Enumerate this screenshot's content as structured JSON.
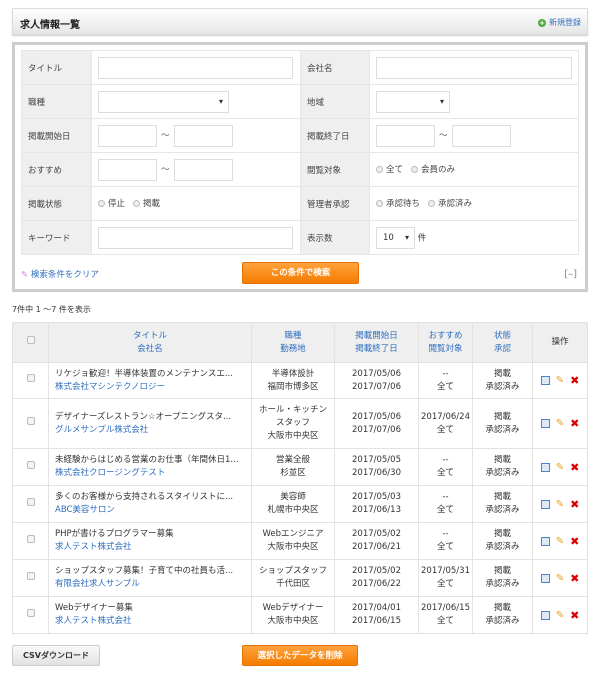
{
  "header": {
    "title": "求人情報一覧",
    "new_label": "新規登録"
  },
  "search": {
    "title_label": "タイトル",
    "company_label": "会社名",
    "job_label": "職種",
    "area_label": "地域",
    "start_label": "掲載開始日",
    "end_label": "掲載終了日",
    "tilde": "～",
    "recommend_label": "おすすめ",
    "view_label": "閲覧対象",
    "view_options": [
      "全て",
      "会員のみ"
    ],
    "status_label": "掲載状態",
    "status_options": [
      "停止",
      "掲載"
    ],
    "approval_label": "管理者承認",
    "approval_options": [
      "承認待ち",
      "承認済み"
    ],
    "keyword_label": "キーワード",
    "count_label": "表示数",
    "count_value": "10",
    "count_unit": "件",
    "clear_label": "検索条件をクリア",
    "search_button": "この条件で検索",
    "collapse": "[–]"
  },
  "result_count": "7件中 1 ～7 件を表示",
  "table": {
    "headers": [
      [
        "タイトル",
        "会社名"
      ],
      [
        "職種",
        "勤務地"
      ],
      [
        "掲載開始日",
        "掲載終了日"
      ],
      [
        "おすすめ",
        "閲覧対象"
      ],
      [
        "状態",
        "承認"
      ],
      [
        "操作"
      ]
    ],
    "rows": [
      {
        "title": "リケジョ歓迎！半導体装置のメンテナンスエ...",
        "company": "株式会社マシンテクノロジー",
        "job": "半導体設計",
        "place": "福岡市博多区",
        "start": "2017/05/06",
        "end": "2017/07/06",
        "rec": "--",
        "view": "全て",
        "status": "掲載",
        "approval": "承認済み"
      },
      {
        "title": "デザイナーズレストラン☆オープニングスタ...",
        "company": "グルメサンプル株式会社",
        "job": "ホール・キッチンスタッフ",
        "place": "大阪市中央区",
        "start": "2017/05/06",
        "end": "2017/07/06",
        "rec": "2017/06/24",
        "view": "全て",
        "status": "掲載",
        "approval": "承認済み"
      },
      {
        "title": "未経験からはじめる営業のお仕事（年間休日1...",
        "company": "株式会社クロージングテスト",
        "job": "営業全般",
        "place": "杉並区",
        "start": "2017/05/05",
        "end": "2017/06/30",
        "rec": "--",
        "view": "全て",
        "status": "掲載",
        "approval": "承認済み"
      },
      {
        "title": "多くのお客様から支持されるスタイリストに...",
        "company": "ABC美容サロン",
        "job": "美容師",
        "place": "札幌市中央区",
        "start": "2017/05/03",
        "end": "2017/06/13",
        "rec": "--",
        "view": "全て",
        "status": "掲載",
        "approval": "承認済み"
      },
      {
        "title": "PHPが書けるプログラマー募集",
        "company": "求人テスト株式会社",
        "job": "Webエンジニア",
        "place": "大阪市中央区",
        "start": "2017/05/02",
        "end": "2017/06/21",
        "rec": "--",
        "view": "全て",
        "status": "掲載",
        "approval": "承認済み"
      },
      {
        "title": "ショップスタッフ募集！子育て中の社員も活...",
        "company": "有限会社求人サンプル",
        "job": "ショップスタッフ",
        "place": "千代田区",
        "start": "2017/05/02",
        "end": "2017/06/22",
        "rec": "2017/05/31",
        "view": "全て",
        "status": "掲載",
        "approval": "承認済み"
      },
      {
        "title": "Webデザイナー募集",
        "company": "求人テスト株式会社",
        "job": "Webデザイナー",
        "place": "大阪市中央区",
        "start": "2017/04/01",
        "end": "2017/06/15",
        "rec": "2017/06/15",
        "view": "全て",
        "status": "掲載",
        "approval": "承認済み"
      }
    ]
  },
  "footer": {
    "csv_button": "CSVダウンロード",
    "delete_button": "選択したデータを削除"
  }
}
